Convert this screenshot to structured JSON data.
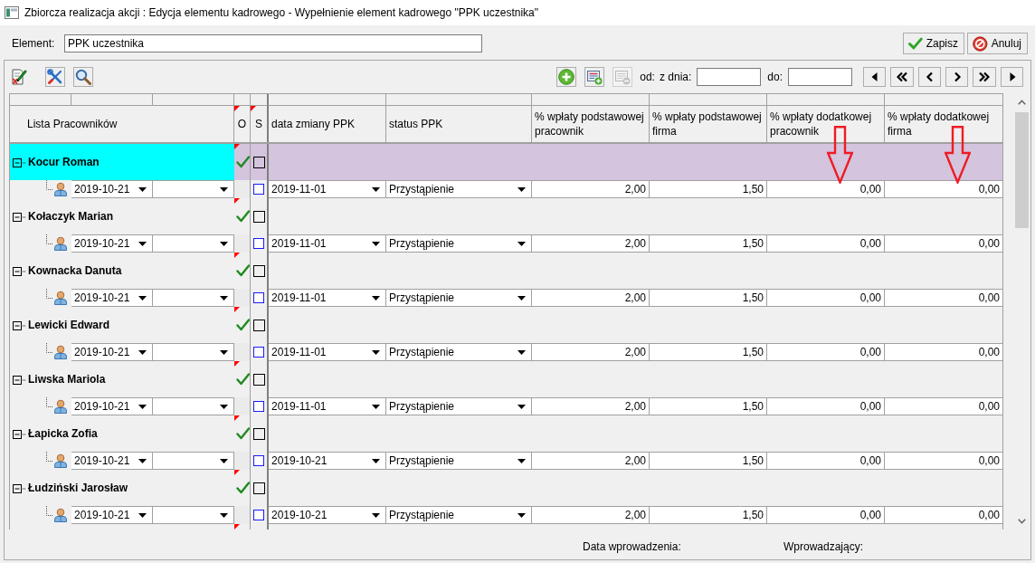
{
  "window": {
    "title": "Zbiorcza realizacja akcji : Edycja elementu kadrowego - Wypełnienie element kadrowego \"PPK uczestnika\""
  },
  "element": {
    "label": "Element:",
    "value": "PPK uczestnika"
  },
  "buttons": [
    {
      "kind": "save",
      "label": "Zapisz"
    },
    {
      "kind": "cancel",
      "label": "Anuluj"
    }
  ],
  "toolbar": {
    "record_buttons": [
      {
        "kind": "add",
        "disabled": false
      },
      {
        "kind": "add-card",
        "disabled": false
      },
      {
        "kind": "remove-card",
        "disabled": true
      }
    ],
    "from_label": "od:",
    "date_from_label": "z dnia:",
    "date_to_label": "do:"
  },
  "grid": {
    "columns": [
      {
        "kind": "tree",
        "label": "Lista Pracowników",
        "marked_with_arrow": false
      },
      {
        "kind": "flag",
        "label": "O",
        "marked_with_arrow": false
      },
      {
        "kind": "flag",
        "label": "S",
        "marked_with_arrow": false
      },
      {
        "kind": "field",
        "label": "data zmiany PPK",
        "marked_with_arrow": false
      },
      {
        "kind": "field",
        "label": "status PPK",
        "marked_with_arrow": false
      },
      {
        "kind": "field",
        "label": "% wpłaty podstawowej pracownik",
        "marked_with_arrow": false
      },
      {
        "kind": "field",
        "label": "% wpłaty podstawowej firma",
        "marked_with_arrow": false
      },
      {
        "kind": "field",
        "label": "% wpłaty dodatkowej pracownik",
        "marked_with_arrow": true
      },
      {
        "kind": "field",
        "label": "% wpłaty dodatkowej firma",
        "marked_with_arrow": true
      }
    ],
    "rows": [
      {
        "name": "Kocur Roman",
        "selected": true,
        "expanded": true,
        "o_checked": true,
        "s_checked": false,
        "children": [
          {
            "date": "2019-10-21",
            "s_checked": false,
            "change_date": "2019-11-01",
            "status": "Przystąpienie",
            "values": [
              "2,00",
              "1,50",
              "0,00",
              "0,00"
            ]
          }
        ]
      },
      {
        "name": "Kołaczyk Marian",
        "selected": false,
        "expanded": true,
        "o_checked": true,
        "s_checked": false,
        "children": [
          {
            "date": "2019-10-21",
            "s_checked": false,
            "change_date": "2019-11-01",
            "status": "Przystąpienie",
            "values": [
              "2,00",
              "1,50",
              "0,00",
              "0,00"
            ]
          }
        ]
      },
      {
        "name": "Kownacka Danuta",
        "selected": false,
        "expanded": true,
        "o_checked": true,
        "s_checked": false,
        "children": [
          {
            "date": "2019-10-21",
            "s_checked": false,
            "change_date": "2019-11-01",
            "status": "Przystąpienie",
            "values": [
              "2,00",
              "1,50",
              "0,00",
              "0,00"
            ]
          }
        ]
      },
      {
        "name": "Lewicki Edward",
        "selected": false,
        "expanded": true,
        "o_checked": true,
        "s_checked": false,
        "children": [
          {
            "date": "2019-10-21",
            "s_checked": false,
            "change_date": "2019-11-01",
            "status": "Przystąpienie",
            "values": [
              "2,00",
              "1,50",
              "0,00",
              "0,00"
            ]
          }
        ]
      },
      {
        "name": "Liwska Mariola",
        "selected": false,
        "expanded": true,
        "o_checked": true,
        "s_checked": false,
        "children": [
          {
            "date": "2019-10-21",
            "s_checked": false,
            "change_date": "2019-11-01",
            "status": "Przystąpienie",
            "values": [
              "2,00",
              "1,50",
              "0,00",
              "0,00"
            ]
          }
        ]
      },
      {
        "name": "Łapicka Zofia",
        "selected": false,
        "expanded": true,
        "o_checked": true,
        "s_checked": false,
        "children": [
          {
            "date": "2019-10-21",
            "s_checked": false,
            "change_date": "2019-10-21",
            "status": "Przystąpienie",
            "values": [
              "2,00",
              "1,50",
              "0,00",
              "0,00"
            ]
          }
        ]
      },
      {
        "name": "Łudziński Jarosław",
        "selected": false,
        "expanded": true,
        "o_checked": true,
        "s_checked": false,
        "children": [
          {
            "date": "2019-10-21",
            "s_checked": false,
            "change_date": "2019-10-21",
            "status": "Przystąpienie",
            "values": [
              "2,00",
              "1,50",
              "0,00",
              "0,00"
            ]
          }
        ]
      }
    ]
  },
  "footer": {
    "entry_date_label": "Data wprowadzenia:",
    "author_label": "Wprowadzający:"
  }
}
